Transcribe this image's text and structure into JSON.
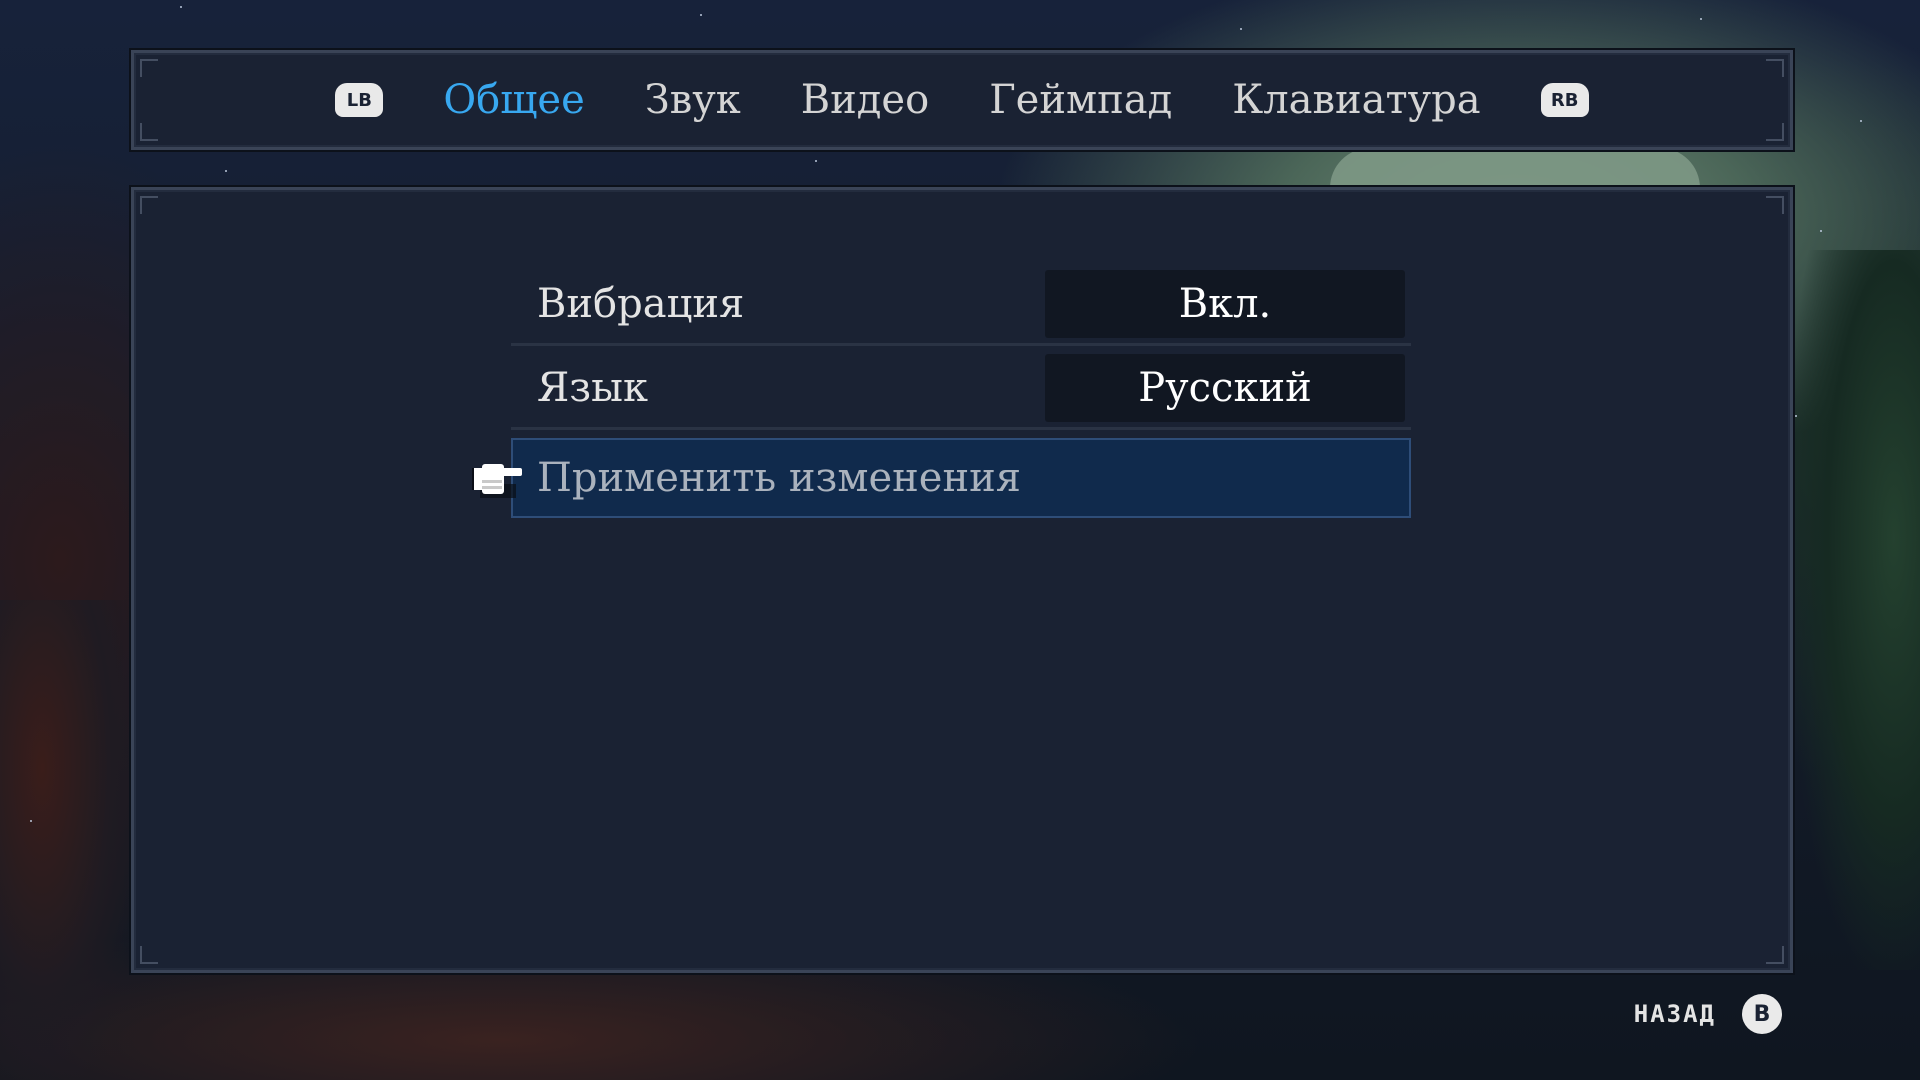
{
  "tabbar": {
    "left_button": "LB",
    "right_button": "RB",
    "tabs": [
      {
        "label": "Общее",
        "active": true
      },
      {
        "label": "Звук",
        "active": false
      },
      {
        "label": "Видео",
        "active": false
      },
      {
        "label": "Геймпад",
        "active": false
      },
      {
        "label": "Клавиатура",
        "active": false
      }
    ]
  },
  "settings": {
    "vibration": {
      "label": "Вибрация",
      "value": "Вкл."
    },
    "language": {
      "label": "Язык",
      "value": "Русский"
    },
    "apply": {
      "label": "Применить изменения",
      "selected": true
    }
  },
  "footer": {
    "back_label": "НАЗАД",
    "back_button": "B"
  },
  "colors": {
    "active_tab": "#38a8f0",
    "panel": "#1a2233",
    "selection": "#102a4c"
  },
  "icons": {
    "pointer": "pointing-hand-icon"
  }
}
